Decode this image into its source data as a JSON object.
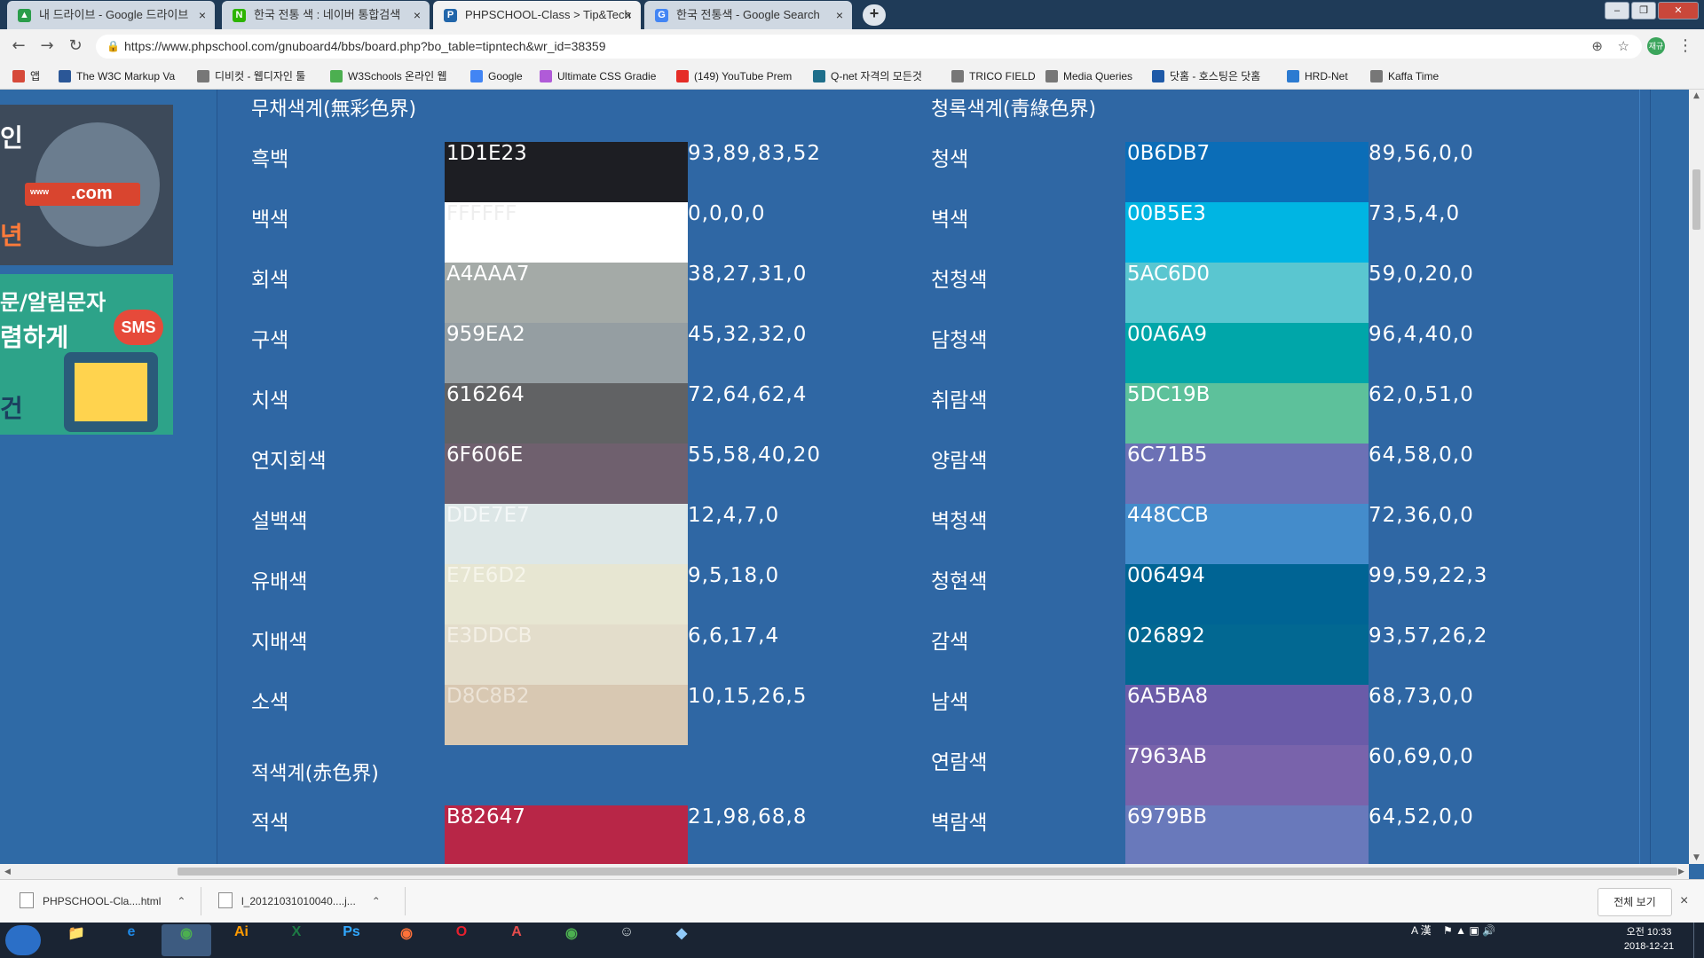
{
  "browser": {
    "tabs": [
      {
        "title": "내 드라이브 - Google 드라이브",
        "fav_color": "#2a9d4a",
        "fav_glyph": "▲",
        "active": false
      },
      {
        "title": "한국 전통 색 : 네이버 통합검색",
        "fav_color": "#2db400",
        "fav_glyph": "N",
        "active": false
      },
      {
        "title": "PHPSCHOOL-Class > Tip&Tech",
        "fav_color": "#2266aa",
        "fav_glyph": "P",
        "active": true
      },
      {
        "title": "한국 전통색 - Google Search",
        "fav_color": "#4285f4",
        "fav_glyph": "G",
        "active": false
      }
    ],
    "new_tab_label": "+",
    "tab_close_glyph": "×",
    "url": "https://www.phpschool.com/gnuboard4/bbs/board.php?bo_table=tipntech&wr_id=38359",
    "profile_initial": "재규",
    "bookmarks": [
      {
        "label": "앱",
        "color": "#d64a3a"
      },
      {
        "label": "The W3C Markup Va",
        "color": "#2b5797"
      },
      {
        "label": "디비컷 - 웹디자인 툴",
        "color": "#777777"
      },
      {
        "label": "W3Schools 온라인 웹",
        "color": "#4caf50"
      },
      {
        "label": "Google",
        "color": "#4285f4"
      },
      {
        "label": "Ultimate CSS Gradie",
        "color": "#b05bd8"
      },
      {
        "label": "(149) YouTube Prem",
        "color": "#e52d27"
      },
      {
        "label": "Q-net 자격의 모든것",
        "color": "#1f6f8b"
      },
      {
        "label": "TRICO FIELD",
        "color": "#777777"
      },
      {
        "label": "Media Queries",
        "color": "#777777"
      },
      {
        "label": "닷홈 - 호스팅은 닷홈",
        "color": "#1e5aa8"
      },
      {
        "label": "HRD-Net",
        "color": "#2c7bd1"
      },
      {
        "label": "Kaffa Time",
        "color": "#777777"
      }
    ]
  },
  "sidebar_ads": {
    "ad1": {
      "fragment_top": "인",
      "fragment_bottom": "년",
      "sign_www": "www",
      "sign_com": ".com"
    },
    "ad2": {
      "line1": "문/알림문자",
      "line2": "렴하게",
      "line3": "건",
      "badge": "SMS"
    }
  },
  "page": {
    "left_heading": "무채색계(無彩色界)",
    "right_heading": "청록색계(靑綠色界)",
    "red_heading": "적색계(赤色界)",
    "left_colors": [
      {
        "name": "흑백",
        "hex": "1D1E23",
        "cmyk": "93,89,83,52",
        "swatch": "#1D1E23",
        "text_color": "#ffffff"
      },
      {
        "name": "백색",
        "hex": "FFFFFF",
        "cmyk": "0,0,0,0",
        "swatch": "#FFFFFF",
        "text_color": "#eeeeee"
      },
      {
        "name": "회색",
        "hex": "A4AAA7",
        "cmyk": "38,27,31,0",
        "swatch": "#A4AAA7",
        "text_color": "#ffffff"
      },
      {
        "name": "구색",
        "hex": "959EA2",
        "cmyk": "45,32,32,0",
        "swatch": "#959EA2",
        "text_color": "#ffffff"
      },
      {
        "name": "치색",
        "hex": "616264",
        "cmyk": "72,64,62,4",
        "swatch": "#616264",
        "text_color": "#ffffff"
      },
      {
        "name": "연지회색",
        "hex": "6F606E",
        "cmyk": "55,58,40,20",
        "swatch": "#6F606E",
        "text_color": "#ffffff"
      },
      {
        "name": "설백색",
        "hex": "DDE7E7",
        "cmyk": "12,4,7,0",
        "swatch": "#DDE7E7",
        "text_color": "#f4f8f8"
      },
      {
        "name": "유배색",
        "hex": "E7E6D2",
        "cmyk": "9,5,18,0",
        "swatch": "#E7E6D2",
        "text_color": "#f6f5ea"
      },
      {
        "name": "지배색",
        "hex": "E3DDCB",
        "cmyk": "6,6,17,4",
        "swatch": "#E3DDCB",
        "text_color": "#f4f0e6"
      },
      {
        "name": "소색",
        "hex": "D8C8B2",
        "cmyk": "10,15,26,5",
        "swatch": "#D8C8B2",
        "text_color": "#ece3d6"
      }
    ],
    "red_colors": [
      {
        "name": "적색",
        "hex": "B82647",
        "cmyk": "21,98,68,8",
        "swatch": "#B82647",
        "text_color": "#ffffff"
      }
    ],
    "right_colors": [
      {
        "name": "청색",
        "hex": "0B6DB7",
        "cmyk": "89,56,0,0",
        "swatch": "#0B6DB7",
        "text_color": "#ffffff"
      },
      {
        "name": "벽색",
        "hex": "00B5E3",
        "cmyk": "73,5,4,0",
        "swatch": "#00B5E3",
        "text_color": "#ffffff"
      },
      {
        "name": "천청색",
        "hex": "5AC6D0",
        "cmyk": "59,0,20,0",
        "swatch": "#5AC6D0",
        "text_color": "#ffffff"
      },
      {
        "name": "담청색",
        "hex": "00A6A9",
        "cmyk": "96,4,40,0",
        "swatch": "#00A6A9",
        "text_color": "#ffffff"
      },
      {
        "name": "취람색",
        "hex": "5DC19B",
        "cmyk": "62,0,51,0",
        "swatch": "#5DC19B",
        "text_color": "#ffffff"
      },
      {
        "name": "양람색",
        "hex": "6C71B5",
        "cmyk": "64,58,0,0",
        "swatch": "#6C71B5",
        "text_color": "#ffffff"
      },
      {
        "name": "벽청색",
        "hex": "448CCB",
        "cmyk": "72,36,0,0",
        "swatch": "#448CCB",
        "text_color": "#ffffff"
      },
      {
        "name": "청현색",
        "hex": "006494",
        "cmyk": "99,59,22,3",
        "swatch": "#006494",
        "text_color": "#ffffff"
      },
      {
        "name": "감색",
        "hex": "026892",
        "cmyk": "93,57,26,2",
        "swatch": "#026892",
        "text_color": "#ffffff"
      },
      {
        "name": "남색",
        "hex": "6A5BA8",
        "cmyk": "68,73,0,0",
        "swatch": "#6A5BA8",
        "text_color": "#ffffff"
      },
      {
        "name": "연람색",
        "hex": "7963AB",
        "cmyk": "60,69,0,0",
        "swatch": "#7963AB",
        "text_color": "#ffffff"
      },
      {
        "name": "벽람색",
        "hex": "6979BB",
        "cmyk": "64,52,0,0",
        "swatch": "#6979BB",
        "text_color": "#ffffff"
      }
    ]
  },
  "downloads": {
    "items": [
      {
        "name": "PHPSCHOOL-Cla....html"
      },
      {
        "name": "l_20121031010040....j..."
      }
    ],
    "show_all": "전체 보기",
    "close_glyph": "×"
  },
  "taskbar": {
    "apps": [
      {
        "name": "explorer",
        "label": "📁",
        "color": "#e8b84a"
      },
      {
        "name": "internet-explorer",
        "label": "e",
        "color": "#1e88e5"
      },
      {
        "name": "chrome",
        "label": "◉",
        "color": "#4caf50",
        "active": true
      },
      {
        "name": "illustrator",
        "label": "Ai",
        "color": "#ff9a00"
      },
      {
        "name": "excel",
        "label": "X",
        "color": "#1d7a45"
      },
      {
        "name": "photoshop",
        "label": "Ps",
        "color": "#31a8ff"
      },
      {
        "name": "firefox",
        "label": "◉",
        "color": "#ff7139"
      },
      {
        "name": "opera",
        "label": "O",
        "color": "#e5202e"
      },
      {
        "name": "acrobat",
        "label": "A",
        "color": "#e44c4c"
      },
      {
        "name": "chrome-2",
        "label": "◉",
        "color": "#4caf50"
      },
      {
        "name": "app-misc",
        "label": "☺",
        "color": "#cfd8dc"
      },
      {
        "name": "app-misc-2",
        "label": "◆",
        "color": "#90caf9"
      }
    ],
    "tray_text": "A 漢",
    "clock_time": "오전 10:33",
    "clock_date": "2018-12-21"
  }
}
